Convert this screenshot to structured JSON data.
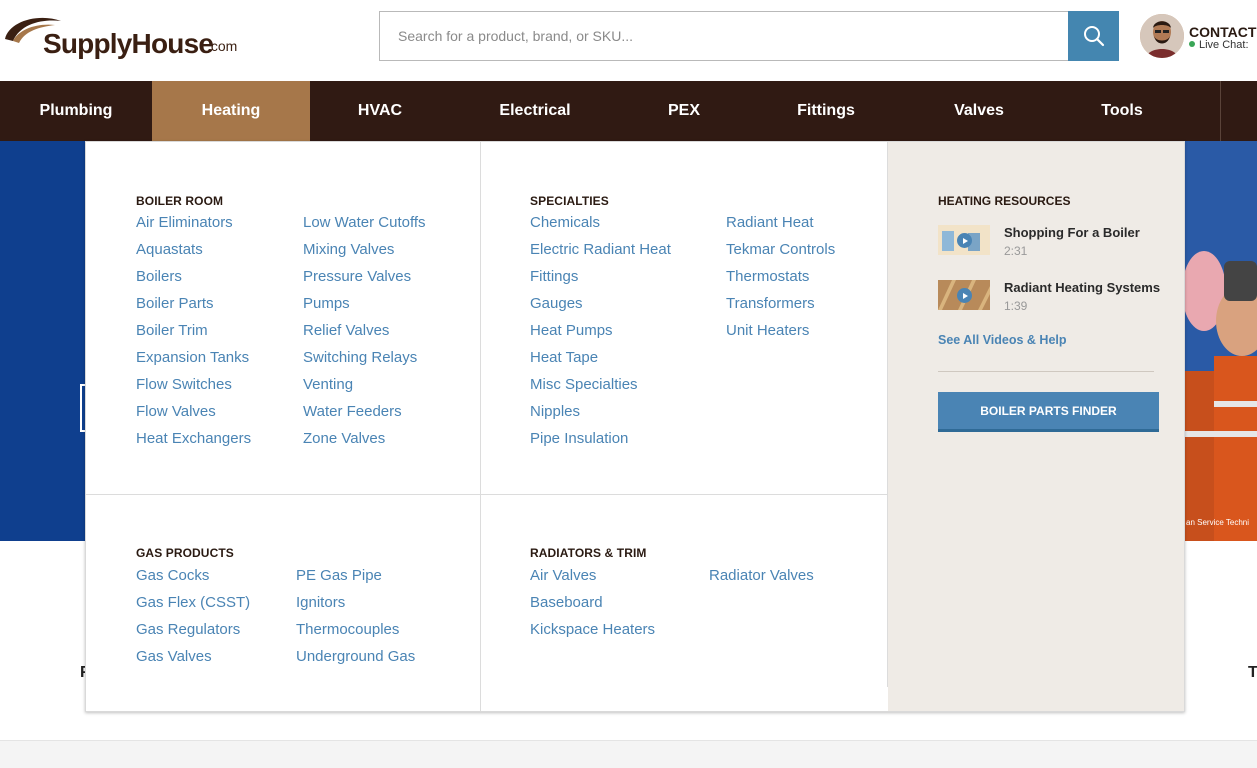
{
  "header": {
    "logo_text": "SupplyHouse",
    "logo_suffix": ".com",
    "search_placeholder": "Search for a product, brand, or SKU...",
    "contact_title": "CONTACT &",
    "contact_sub": "Live Chat:"
  },
  "nav": {
    "items": [
      "Plumbing",
      "Heating",
      "HVAC",
      "Electrical",
      "PEX",
      "Fittings",
      "Valves",
      "Tools"
    ],
    "active": "Heating"
  },
  "hero": {
    "caption": "an Service Techni"
  },
  "edge": {
    "left_letter": "F",
    "right_letter": "T"
  },
  "menu": {
    "boiler_room": {
      "title": "BOILER ROOM",
      "col1": [
        "Air Eliminators",
        "Aquastats",
        "Boilers",
        "Boiler Parts",
        "Boiler Trim",
        "Expansion Tanks",
        "Flow Switches",
        "Flow Valves",
        "Heat Exchangers"
      ],
      "col2": [
        "Low Water Cutoffs",
        "Mixing Valves",
        "Pressure Valves",
        "Pumps",
        "Relief Valves",
        "Switching Relays",
        "Venting",
        "Water Feeders",
        "Zone Valves"
      ]
    },
    "specialties": {
      "title": "SPECIALTIES",
      "col1": [
        "Chemicals",
        "Electric Radiant Heat",
        "Fittings",
        "Gauges",
        "Heat Pumps",
        "Heat Tape",
        "Misc Specialties",
        "Nipples",
        "Pipe Insulation"
      ],
      "col2": [
        "Radiant Heat",
        "Tekmar Controls",
        "Thermostats",
        "Transformers",
        "Unit Heaters"
      ]
    },
    "gas_products": {
      "title": "GAS PRODUCTS",
      "col1": [
        "Gas Cocks",
        "Gas Flex (CSST)",
        "Gas Regulators",
        "Gas Valves"
      ],
      "col2": [
        "PE Gas Pipe",
        "Ignitors",
        "Thermocouples",
        "Underground Gas"
      ]
    },
    "radiators": {
      "title": "RADIATORS & TRIM",
      "col1": [
        "Air Valves",
        "Baseboard",
        "Kickspace Heaters"
      ],
      "col2": [
        "Radiator Valves"
      ]
    },
    "resources": {
      "title": "HEATING RESOURCES",
      "videos": [
        {
          "title": "Shopping For a Boiler",
          "duration": "2:31"
        },
        {
          "title": "Radiant Heating Systems",
          "duration": "1:39"
        }
      ],
      "see_all": "See All Videos & Help",
      "finder_button": "BOILER PARTS FINDER"
    }
  },
  "colors": {
    "nav_bg": "#301a13",
    "nav_active": "#a6774a",
    "link": "#4a84b4",
    "search_button": "#4486b0",
    "hero_blue": "#0f3f8e",
    "resources_bg": "#efebe6"
  }
}
